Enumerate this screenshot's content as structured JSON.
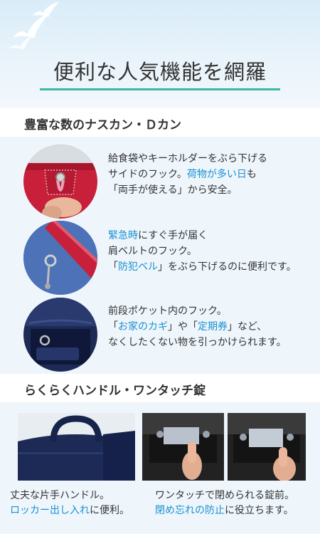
{
  "header": {
    "title": "便利な人気機能を網羅"
  },
  "section1": {
    "title": "豊富な数のナスカン・Ｄカン",
    "features": [
      {
        "lines": [
          {
            "parts": [
              {
                "text": "給食袋やキーホルダーをぶら下げる",
                "hl": false
              }
            ]
          },
          {
            "parts": [
              {
                "text": "サイドのフック。",
                "hl": false
              },
              {
                "text": "荷物が多い日",
                "hl": true
              },
              {
                "text": "も",
                "hl": false
              }
            ]
          },
          {
            "parts": [
              {
                "text": "「両手が使える」から安全。",
                "hl": false
              }
            ]
          }
        ]
      },
      {
        "lines": [
          {
            "parts": [
              {
                "text": "緊急時",
                "hl": true
              },
              {
                "text": "にすぐ手が届く",
                "hl": false
              }
            ]
          },
          {
            "parts": [
              {
                "text": "肩ベルトのフック。",
                "hl": false
              }
            ]
          },
          {
            "parts": [
              {
                "text": "「",
                "hl": false
              },
              {
                "text": "防犯ベル",
                "hl": true
              },
              {
                "text": "」をぶら下げるのに便利です。",
                "hl": false
              }
            ]
          }
        ]
      },
      {
        "lines": [
          {
            "parts": [
              {
                "text": "前段ポケット内のフック。",
                "hl": false
              }
            ]
          },
          {
            "parts": [
              {
                "text": "「",
                "hl": false
              },
              {
                "text": "お家のカギ",
                "hl": true
              },
              {
                "text": "」や「",
                "hl": false
              },
              {
                "text": "定期券",
                "hl": true
              },
              {
                "text": "」など、",
                "hl": false
              }
            ]
          },
          {
            "parts": [
              {
                "text": "なくしたくない物を引っかけられます。",
                "hl": false
              }
            ]
          }
        ]
      }
    ]
  },
  "section2": {
    "title": "らくらくハンドル・ワンタッチ錠",
    "left_caption": {
      "line1": "丈夫な片手ハンドル。",
      "line2_hl": "ロッカー出し入れ",
      "line2_rest": "に便利。"
    },
    "right_caption": {
      "line1": "ワンタッチで閉められる錠前。",
      "line2_hl": "閉め忘れの防止",
      "line2_rest": "に役立ちます。"
    }
  },
  "colors": {
    "accent_line": "#3fb7a6",
    "highlight": "#1a8fd1",
    "bag_red": "#c8203a",
    "bag_navy": "#1c2a55"
  }
}
